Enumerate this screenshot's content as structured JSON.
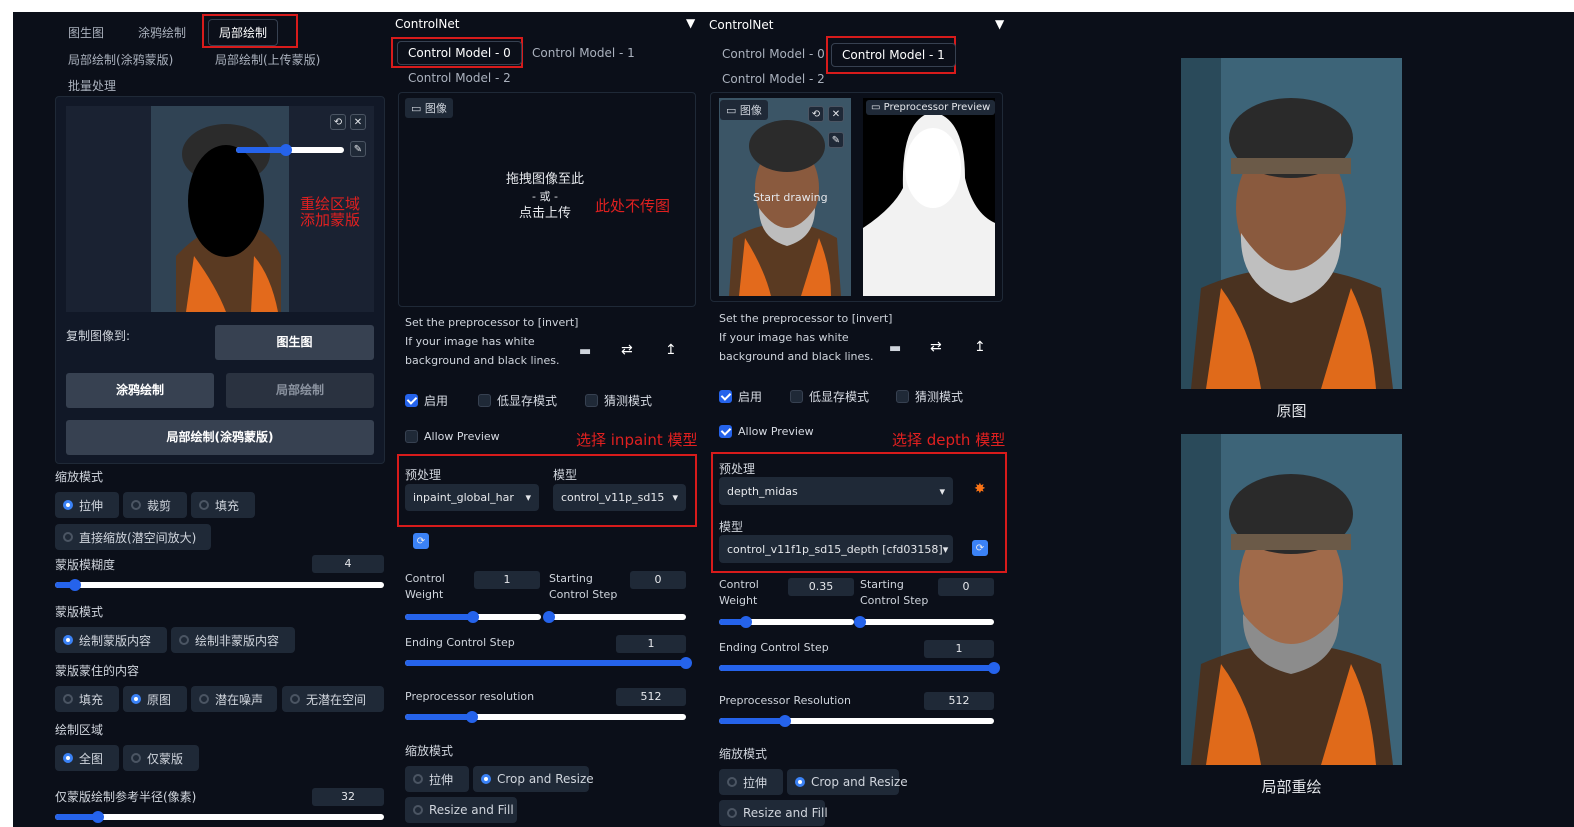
{
  "left": {
    "tabs": [
      "图生图",
      "涂鸦绘制",
      "局部绘制",
      "局部绘制(涂鸦蒙版)",
      "局部绘制(上传蒙版)",
      "批量处理"
    ],
    "annotation_mask": "重绘区域\n添加蒙版",
    "copy_to_label": "复制图像到:",
    "buttons": {
      "img2img": "图生图",
      "sketch": "涂鸦绘制",
      "inpaint": "局部绘制",
      "inpaint_sketch": "局部绘制(涂鸦蒙版)"
    },
    "resize_mode_label": "缩放模式",
    "resize_modes": [
      "拉伸",
      "裁剪",
      "填充",
      "直接缩放(潜空间放大)"
    ],
    "mask_blur_label": "蒙版模糊度",
    "mask_blur_value": "4",
    "mask_blur_fraction": 0.06,
    "mask_mode_label": "蒙版模式",
    "mask_modes": [
      "绘制蒙版内容",
      "绘制非蒙版内容"
    ],
    "masked_content_label": "蒙版蒙住的内容",
    "masked_contents": [
      "填充",
      "原图",
      "潜在噪声",
      "无潜在空间"
    ],
    "inpaint_area_label": "绘制区域",
    "inpaint_areas": [
      "全图",
      "仅蒙版"
    ],
    "padding_label": "仅蒙版绘制参考半径(像素)",
    "padding_value": "32",
    "padding_fraction": 0.13
  },
  "cn1": {
    "title": "ControlNet",
    "tabs": [
      "Control Model - 0",
      "Control Model - 1",
      "Control Model - 2"
    ],
    "image_tab": "图像",
    "drop_text": [
      "拖拽图像至此",
      "- 或 -",
      "点击上传"
    ],
    "annotation_no_upload": "此处不传图",
    "invert_hint": [
      "Set the preprocessor to [invert]",
      "If your image has white",
      "background and black lines."
    ],
    "enable": "启用",
    "lowvram": "低显存模式",
    "guess": "猜测模式",
    "allow_preview": "Allow Preview",
    "annotation_model": "选择 inpaint 模型",
    "preprocessor_label": "预处理",
    "model_label": "模型",
    "preprocessor_value": "inpaint_global_har",
    "model_value": "control_v11p_sd15",
    "control_weight_label": "Control Weight",
    "control_weight_value": "1",
    "control_weight_fraction": 0.5,
    "start_step_label": "Starting Control Step",
    "start_step_value": "0",
    "start_step_fraction": 0.0,
    "end_step_label": "Ending Control Step",
    "end_step_value": "1",
    "end_step_fraction": 1.0,
    "pre_res_label": "Preprocessor resolution",
    "pre_res_value": "512",
    "pre_res_fraction": 0.24,
    "resize_label": "缩放模式",
    "resize_modes": [
      "拉伸",
      "Crop and Resize",
      "Resize and Fill"
    ]
  },
  "cn2": {
    "title": "ControlNet",
    "tabs": [
      "Control Model - 0",
      "Control Model - 1",
      "Control Model - 2"
    ],
    "image_tab": "图像",
    "preview_tab": "Preprocessor Preview",
    "start_drawing": "Start drawing",
    "invert_hint": [
      "Set the preprocessor to [invert]",
      "If your image has white",
      "background and black lines."
    ],
    "enable": "启用",
    "lowvram": "低显存模式",
    "guess": "猜测模式",
    "allow_preview": "Allow Preview",
    "annotation_model": "选择 depth 模型",
    "preprocessor_label": "预处理",
    "preprocessor_value": "depth_midas",
    "model_label": "模型",
    "model_value": "control_v11f1p_sd15_depth [cfd03158]",
    "control_weight_label": "Control Weight",
    "control_weight_value": "0.35",
    "control_weight_fraction": 0.2,
    "start_step_label": "Starting Control Step",
    "start_step_value": "0",
    "start_step_fraction": 0.0,
    "end_step_label": "Ending Control Step",
    "end_step_value": "1",
    "end_step_fraction": 1.0,
    "pre_res_label": "Preprocessor Resolution",
    "pre_res_value": "512",
    "pre_res_fraction": 0.24,
    "resize_label": "缩放模式",
    "resize_modes": [
      "拉伸",
      "Crop and Resize",
      "Resize and Fill"
    ]
  },
  "results": {
    "original_caption": "原图",
    "inpaint_caption": "局部重绘"
  },
  "colors": {
    "accent": "#2563eb",
    "annotation_red": "#e02020",
    "panel_bg": "#0b0f19"
  }
}
